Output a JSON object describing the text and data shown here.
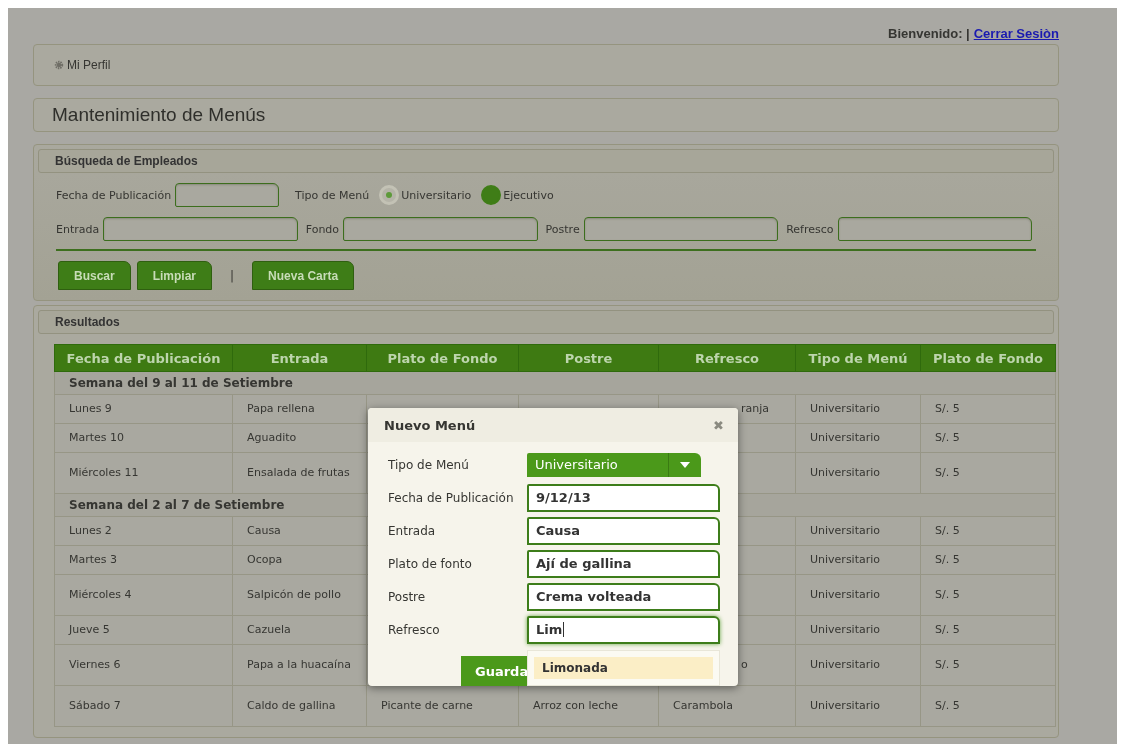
{
  "header": {
    "welcome": "Bienvenido: |",
    "logout": "Cerrar Sesiòn"
  },
  "profile": {
    "label": "Mi Perfil"
  },
  "page_title": "Mantenimiento de Menús",
  "search": {
    "title": "Búsqueda de Empleados",
    "date_label": "Fecha de Publicación",
    "menu_type_label": "Tipo de Menú",
    "menu_types": [
      {
        "label": "Universitario",
        "selected": true
      },
      {
        "label": "Ejecutivo",
        "selected": false
      }
    ],
    "fields": [
      {
        "label": "Entrada"
      },
      {
        "label": "Fondo"
      },
      {
        "label": "Postre"
      },
      {
        "label": "Refresco"
      }
    ],
    "buttons": [
      "Buscar",
      "Limpiar"
    ],
    "separator": "|",
    "new_button": "Nueva Carta"
  },
  "results": {
    "title": "Resultados",
    "columns": [
      "Fecha de Publicación",
      "Entrada",
      "Plato de Fondo",
      "Postre",
      "Refresco",
      "Tipo de Menú",
      "Plato de Fondo"
    ],
    "rows": [
      {
        "kind": "group",
        "label": "Semana del 9 al 11 de Setiembre"
      },
      {
        "kind": "row",
        "cells": [
          {
            "text": "Lunes 9"
          },
          {
            "text": "Papa rellena"
          },
          null,
          null,
          {
            "text": "ranja",
            "cut": true
          },
          {
            "text": "Universitario"
          },
          {
            "text": "S/. 5"
          }
        ]
      },
      {
        "kind": "row",
        "cells": [
          {
            "text": "Martes 10"
          },
          {
            "text": "Aguadito"
          },
          null,
          null,
          null,
          {
            "text": "Universitario"
          },
          {
            "text": "S/. 5"
          }
        ]
      },
      {
        "kind": "row",
        "cells": [
          {
            "text": "Miércoles 11"
          },
          {
            "text": "Ensalada de frutas"
          },
          null,
          null,
          null,
          {
            "text": "Universitario"
          },
          {
            "text": "S/. 5"
          }
        ]
      },
      {
        "kind": "group",
        "label": "Semana del 2 al 7 de Setiembre"
      },
      {
        "kind": "row",
        "cells": [
          {
            "text": "Lunes 2"
          },
          {
            "text": "Causa"
          },
          null,
          null,
          null,
          {
            "text": "Universitario"
          },
          {
            "text": "S/. 5"
          }
        ]
      },
      {
        "kind": "row",
        "cells": [
          {
            "text": "Martes 3"
          },
          {
            "text": "Ocopa"
          },
          null,
          null,
          null,
          {
            "text": "Universitario"
          },
          {
            "text": "S/. 5"
          }
        ]
      },
      {
        "kind": "row",
        "cells": [
          {
            "text": "Miércoles 4"
          },
          {
            "text": "Salpicón de pollo"
          },
          null,
          null,
          null,
          {
            "text": "Universitario"
          },
          {
            "text": "S/. 5"
          }
        ]
      },
      {
        "kind": "row",
        "cells": [
          {
            "text": "Jueve 5"
          },
          {
            "text": "Cazuela"
          },
          null,
          null,
          null,
          {
            "text": "Universitario"
          },
          {
            "text": "S/. 5"
          }
        ]
      },
      {
        "kind": "row",
        "cells": [
          {
            "text": "Viernes 6"
          },
          {
            "text": "Papa a la huacaína"
          },
          null,
          null,
          {
            "text": "o",
            "cut": true
          },
          {
            "text": "Universitario"
          },
          {
            "text": "S/. 5"
          }
        ]
      },
      {
        "kind": "row",
        "cells": [
          {
            "text": "Sábado 7"
          },
          {
            "text": "Caldo de gallina"
          },
          {
            "text": "Picante de carne"
          },
          {
            "text": "Arroz con leche"
          },
          {
            "text": "Carambola"
          },
          {
            "text": "Universitario"
          },
          {
            "text": "S/. 5"
          }
        ]
      }
    ]
  },
  "dialog": {
    "title": "Nuevo Menú",
    "close": "✖",
    "fields": [
      {
        "kind": "select",
        "label": "Tipo de Menú",
        "value": "Universitario"
      },
      {
        "kind": "text",
        "label": "Fecha de Publicación",
        "value": "9/12/13",
        "focused": false
      },
      {
        "kind": "text",
        "label": "Entrada",
        "value": "Causa",
        "focused": false
      },
      {
        "kind": "text",
        "label": "Plato de fonto",
        "value": "Ají de gallina",
        "focused": false
      },
      {
        "kind": "text",
        "label": "Postre",
        "value": "Crema volteada",
        "focused": false
      },
      {
        "kind": "text",
        "label": "Refresco",
        "value": "Lim",
        "focused": true
      }
    ],
    "save_button": "Guarda",
    "suggestions": [
      "**Lim**onada"
    ]
  }
}
